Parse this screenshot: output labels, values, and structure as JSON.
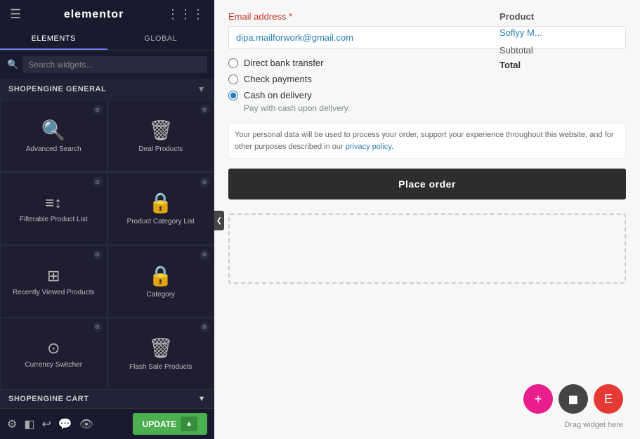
{
  "header": {
    "hamburger": "☰",
    "brand": "elementor",
    "grid": "⋮⋮⋮"
  },
  "tabs": [
    {
      "id": "elements",
      "label": "ELEMENTS",
      "active": true
    },
    {
      "id": "global",
      "label": "GLOBAL",
      "active": false
    }
  ],
  "search": {
    "placeholder": "Search widgets..."
  },
  "sections": {
    "shopengine_general": {
      "label": "SHOPENGINE GENERAL",
      "widgets": [
        {
          "id": "advanced-search",
          "label": "Advanced Search",
          "icon": "🔍"
        },
        {
          "id": "deal-products",
          "label": "Deal Products",
          "icon": "🗑"
        },
        {
          "id": "filterable-product-list",
          "label": "Filterable Product List",
          "icon": "☰"
        },
        {
          "id": "product-category-list",
          "label": "Product Category List",
          "icon": "🔒"
        },
        {
          "id": "recently-viewed-products",
          "label": "Recently Viewed Products",
          "icon": "⊞"
        },
        {
          "id": "category",
          "label": "Category",
          "icon": "🔒"
        },
        {
          "id": "currency-switcher",
          "label": "Currency Switcher",
          "icon": "⊙"
        },
        {
          "id": "flash-sale-products",
          "label": "Flash Sale Products",
          "icon": "🗑"
        }
      ]
    },
    "shopengine_cart": {
      "label": "SHOPENGINE CART"
    }
  },
  "bottom_bar": {
    "icons": [
      "⚙",
      "◧",
      "↩",
      "💬",
      "👁"
    ],
    "update_label": "UPDATE",
    "arrow": "▲"
  },
  "right": {
    "email_label": "Email address *",
    "email_value": "dipa.mailforwork@gmail.com",
    "payment_options": [
      {
        "id": "bank",
        "label": "Direct bank transfer",
        "selected": false
      },
      {
        "id": "check",
        "label": "Check payments",
        "selected": false
      },
      {
        "id": "cash",
        "label": "Cash on delivery",
        "selected": true,
        "desc": "Pay with cash upon delivery."
      }
    ],
    "notice_text": "Your personal data will be used to process your order, support your experience throughout this website, and for other purposes described in our ",
    "notice_link": "privacy policy",
    "place_order_label": "Place order",
    "product_header": "Product",
    "product_name": "Soflyy M...",
    "subtotal_label": "Subtotal",
    "total_label": "Total",
    "drag_label": "Drag widget here",
    "fabs": [
      {
        "id": "add",
        "icon": "+",
        "color": "pink"
      },
      {
        "id": "stop",
        "icon": "◼",
        "color": "dark"
      },
      {
        "id": "edit",
        "icon": "E",
        "color": "red"
      }
    ]
  },
  "collapse_arrow": "❮"
}
